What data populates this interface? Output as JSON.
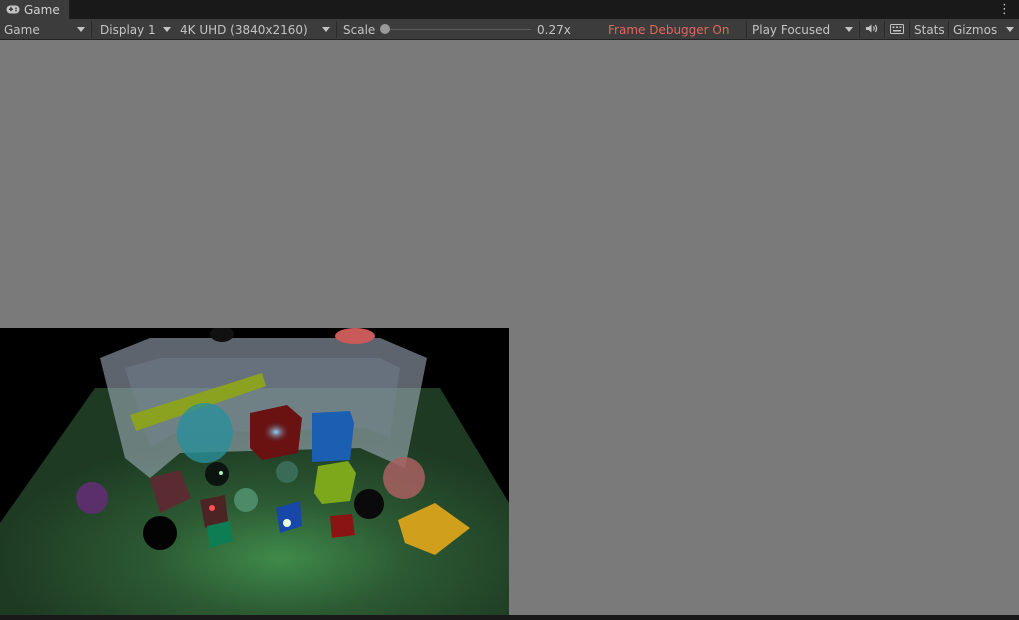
{
  "tab": {
    "label": "Game",
    "icon": "gamepad-icon"
  },
  "toolbar": {
    "view_mode": "Game",
    "display": "Display 1",
    "resolution": "4K UHD (3840x2160)",
    "scale_label": "Scale",
    "scale_value": "0.27x",
    "frame_debugger": "Frame Debugger On",
    "play_mode": "Play Focused",
    "stats": "Stats",
    "gizmos": "Gizmos",
    "audio_icon": "speaker-icon",
    "keyboard_icon": "keyboard-icon",
    "menu_icon": "kebab-menu-icon"
  },
  "colors": {
    "toolbar_bg": "#3c3c3c",
    "tab_strip_bg": "#191919",
    "viewport_bg": "#7a7a7a",
    "frame_debugger_text": "#e0675b"
  }
}
